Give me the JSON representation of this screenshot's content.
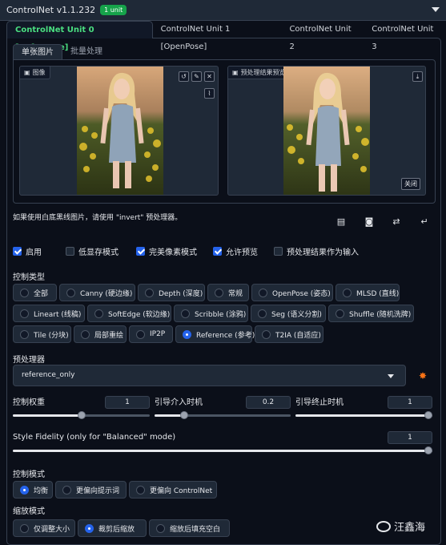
{
  "header": {
    "title": "ControlNet v1.1.232",
    "badge": "1 unit"
  },
  "unit_tabs": [
    "ControlNet Unit 0 [Reference]",
    "ControlNet Unit 1 [OpenPose]",
    "ControlNet Unit 2",
    "ControlNet Unit 3"
  ],
  "image_tabs": [
    "单张图片",
    "批量处理"
  ],
  "image_panel": {
    "label": "图像",
    "watermark_text": "汪鑫海"
  },
  "preview_panel": {
    "label": "预处理结果预览",
    "close_label": "关闭"
  },
  "hint": "如果使用白底黑线图片，请使用 \"invert\" 预处理器。",
  "options": [
    {
      "label": "启用",
      "checked": true
    },
    {
      "label": "低显存模式",
      "checked": false
    },
    {
      "label": "完美像素模式",
      "checked": true
    },
    {
      "label": "允许预览",
      "checked": true
    },
    {
      "label": "预处理结果作为输入",
      "checked": false
    }
  ],
  "control_type": {
    "label": "控制类型",
    "rows": [
      [
        "全部",
        "Canny (硬边缘)",
        "Depth (深度)",
        "常规",
        "OpenPose (姿态)",
        "MLSD (直线)"
      ],
      [
        "Lineart (线稿)",
        "SoftEdge (软边缘)",
        "Scribble (涂鸦)",
        "Seg (语义分割)",
        "Shuffle (随机洗牌)"
      ],
      [
        "Tile (分块)",
        "局部重绘",
        "IP2P",
        "Reference (参考)",
        "T2IA (自适应)"
      ]
    ],
    "selected": "Reference (参考)"
  },
  "preprocessor": {
    "label": "预处理器",
    "value": "reference_only"
  },
  "sliders": {
    "weight": {
      "label": "控制权重",
      "value": "1",
      "fraction": 0.5
    },
    "start": {
      "label": "引导介入时机",
      "value": "0.2",
      "fraction": 0.2
    },
    "end": {
      "label": "引导终止时机",
      "value": "1",
      "fraction": 1.0
    },
    "fidelity": {
      "label": "Style Fidelity (only for \"Balanced\" mode)",
      "value": "1",
      "fraction": 1.0
    }
  },
  "control_mode": {
    "label": "控制模式",
    "options": [
      "均衡",
      "更偏向提示词",
      "更偏向 ControlNet"
    ],
    "selected": "均衡"
  },
  "resize_mode": {
    "label": "缩放模式",
    "options": [
      "仅调整大小",
      "裁剪后缩放",
      "缩放后填充空白"
    ],
    "selected": "裁剪后缩放"
  },
  "footer_watermark": "汪鑫海",
  "colors": {
    "accent": "#2563eb",
    "active_tab": "#4ade80",
    "badge": "#16a34a",
    "star": "#f97316"
  }
}
